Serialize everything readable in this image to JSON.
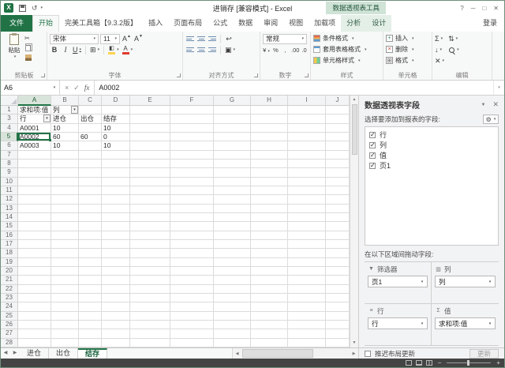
{
  "title_bar": {
    "title": "进销存 [兼容模式] - Excel",
    "contextual_tools": "数据透视表工具"
  },
  "icons": {
    "dropdown": "▾",
    "up": "▲",
    "down": "▼",
    "left": "◀",
    "right": "▶",
    "scissors": "✂",
    "bold": "B",
    "italic": "I",
    "underline": "U",
    "font_letter": "A",
    "borders": "⊞",
    "merge": "▣",
    "wrap": "↩",
    "currency": "¥",
    "percent": "%",
    "comma": ",",
    "inc_decimal": ".00",
    "dec_decimal": ".0",
    "sigma": "Σ",
    "fill_down": "↓",
    "clear": "✕",
    "sort": "⇅",
    "gear": "⚙",
    "check": "✓",
    "cross": "×",
    "fx": "fx",
    "undo": "↺",
    "help": "?",
    "minimize": "─",
    "restore": "□",
    "close": "✕"
  },
  "ribbon": {
    "tabs": [
      {
        "label": "文件",
        "type": "file"
      },
      {
        "label": "开始",
        "type": "active"
      },
      {
        "label": "完美工具箱【9.3.2版】"
      },
      {
        "label": "插入"
      },
      {
        "label": "页面布局"
      },
      {
        "label": "公式"
      },
      {
        "label": "数据"
      },
      {
        "label": "审阅"
      },
      {
        "label": "视图"
      },
      {
        "label": "加载项"
      },
      {
        "label": "分析",
        "type": "contextual"
      },
      {
        "label": "设计",
        "type": "contextual"
      }
    ],
    "sign_in": "登录",
    "paste_label": "粘贴",
    "font": {
      "name": "宋体",
      "size": "11"
    },
    "number_format": "常规",
    "style_buttons": [
      "条件格式",
      "套用表格格式",
      "单元格样式"
    ],
    "cell_buttons": [
      "插入",
      "删除",
      "格式"
    ],
    "group_labels": [
      "剪贴板",
      "字体",
      "对齐方式",
      "数字",
      "样式",
      "单元格",
      "编辑"
    ]
  },
  "formula_bar": {
    "name_box": "A6",
    "value": "A0002"
  },
  "grid": {
    "columns": [
      "A",
      "B",
      "C",
      "D",
      "E",
      "F",
      "G",
      "H",
      "I",
      "J"
    ],
    "row_numbers": [
      "1",
      "3",
      "4",
      "5",
      "6",
      "7",
      "8",
      "9",
      "10",
      "11",
      "12",
      "13",
      "14",
      "15",
      "16",
      "17",
      "18",
      "19",
      "20",
      "21",
      "22",
      "23",
      "24",
      "25",
      "26",
      "27",
      "28"
    ],
    "cells": {
      "1": {
        "A": "求和项:值",
        "B": "列"
      },
      "3": {
        "A": "行",
        "B": "进仓",
        "C": "出仓",
        "D": "结存"
      },
      "4": {
        "A": "A0001",
        "B": "10",
        "D": "10"
      },
      "5": {
        "A": "A0002",
        "B": "60",
        "C": "60",
        "D": "0"
      },
      "6": {
        "A": "A0003",
        "B": "10",
        "D": "10"
      }
    },
    "dropdown_cells": [
      "1:B",
      "3:A"
    ],
    "selected": {
      "row": "5",
      "col": "A"
    }
  },
  "sheet_tabs": {
    "tabs": [
      {
        "label": "进仓",
        "active": false
      },
      {
        "label": "出仓",
        "active": false
      },
      {
        "label": "结存",
        "active": true
      }
    ]
  },
  "pane": {
    "title": "数据透视表字段",
    "choose_label": "选择要添加到报表的字段:",
    "fields": [
      {
        "label": "行",
        "checked": true
      },
      {
        "label": "列",
        "checked": true
      },
      {
        "label": "值",
        "checked": true
      },
      {
        "label": "页1",
        "checked": true
      }
    ],
    "drag_label": "在以下区域间拖动字段:",
    "areas": [
      {
        "glyph": "▼",
        "label": "筛选器",
        "field": "页1"
      },
      {
        "glyph": "▥",
        "label": "列",
        "field": "列"
      },
      {
        "glyph": "≡",
        "label": "行",
        "field": "行"
      },
      {
        "glyph": "Σ",
        "label": "值",
        "field": "求和项:值"
      }
    ],
    "defer_label": "推迟布局更新",
    "update_button": "更新"
  }
}
